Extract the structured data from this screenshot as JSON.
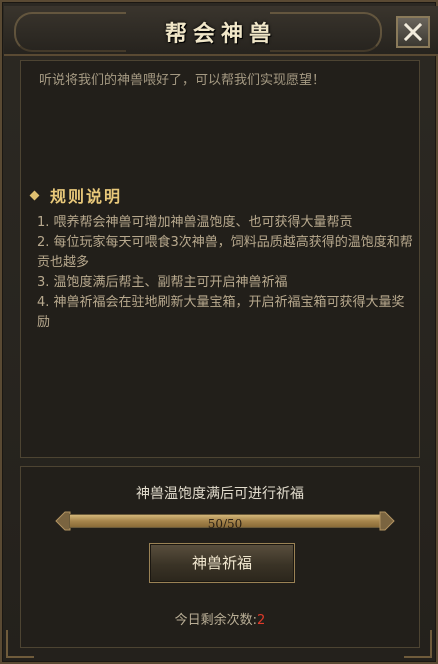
{
  "dialog": {
    "title": "帮会神兽",
    "close_label": "关闭"
  },
  "intro_text": "听说将我们的神兽喂好了，可以帮我们实现愿望！",
  "rules": {
    "heading": "规则说明",
    "items": [
      "1. 喂养帮会神兽可增加神兽温饱度、也可获得大量帮贡",
      "2. 每位玩家每天可喂食3次神兽，饲料品质越高获得的温饱度和帮贡也越多",
      "3. 温饱度满后帮主、副帮主可开启神兽祈福",
      "4. 神兽祈福会在驻地刷新大量宝箱，开启祈福宝箱可获得大量奖励"
    ]
  },
  "bless_section": {
    "condition_text": "神兽温饱度满后可进行祈福",
    "progress": {
      "current": 50,
      "max": 50,
      "label": "50/50"
    },
    "button_label": "神兽祈福",
    "remaining_label": "今日剩余次数:",
    "remaining_count": "2"
  },
  "colors": {
    "accent_gold": "#e8c87a",
    "remaining_red": "#e03a2a"
  }
}
